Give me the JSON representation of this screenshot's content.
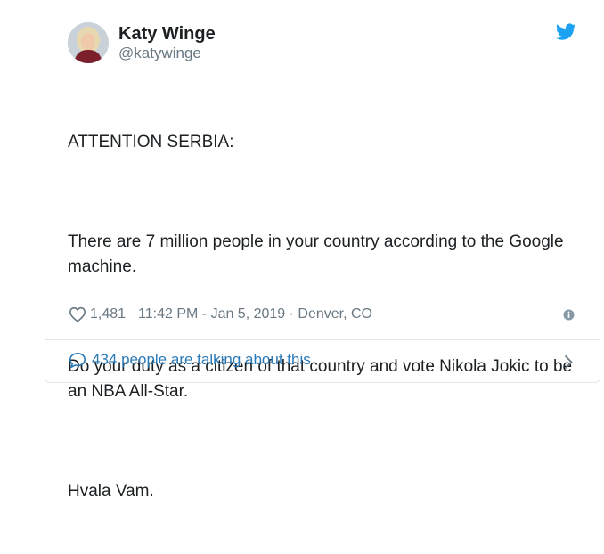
{
  "author": {
    "display_name": "Katy Winge",
    "handle": "@katywinge"
  },
  "tweet": {
    "paragraphs": [
      "ATTENTION SERBIA:",
      "There are 7 million people in your country according to the Google machine.",
      "Do your duty as a citizen of that country and vote Nikola Jokic to be an NBA All-Star.",
      "Hvala Vam."
    ]
  },
  "meta": {
    "likes": "1,481",
    "timestamp_location": "11:42 PM - Jan 5, 2019 · Denver, CO"
  },
  "footer": {
    "conversation_label": "434 people are talking about this"
  },
  "icons": {
    "bird": "twitter-bird-icon",
    "heart": "heart-icon",
    "info": "info-icon",
    "bubble": "speech-bubble-icon",
    "chevron": "chevron-right-icon"
  },
  "colors": {
    "twitter_blue": "#1da1f2",
    "link_blue": "#2b7bb9",
    "meta_gray": "#697882",
    "border": "#e1e8ed"
  }
}
